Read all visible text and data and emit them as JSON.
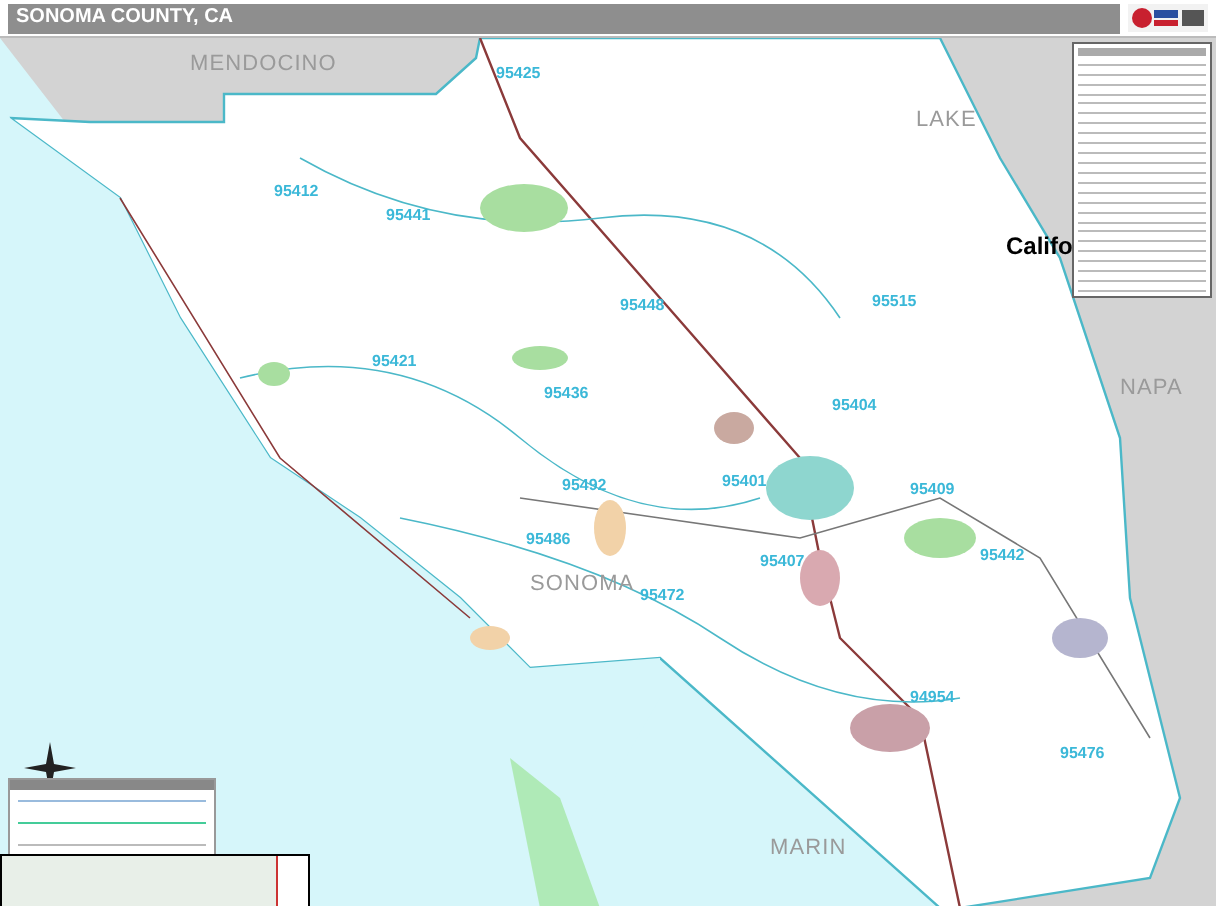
{
  "title": "SONOMA COUNTY, CA",
  "map_labels": [
    {
      "kind": "county",
      "text": "MENDOCINO"
    },
    {
      "kind": "county",
      "text": "LAKE"
    },
    {
      "kind": "state",
      "text": "Califo"
    },
    {
      "kind": "county",
      "text": "NAPA"
    },
    {
      "kind": "county",
      "text": "SONOMA"
    },
    {
      "kind": "county",
      "text": "MARIN"
    },
    {
      "kind": "zip",
      "text": "95425"
    },
    {
      "kind": "zip",
      "text": "95412"
    },
    {
      "kind": "zip",
      "text": "95441"
    },
    {
      "kind": "zip",
      "text": "95448"
    },
    {
      "kind": "zip",
      "text": "95515"
    },
    {
      "kind": "zip",
      "text": "95421"
    },
    {
      "kind": "zip",
      "text": "95436"
    },
    {
      "kind": "zip",
      "text": "95404"
    },
    {
      "kind": "zip",
      "text": "95401"
    },
    {
      "kind": "zip",
      "text": "95409"
    },
    {
      "kind": "zip",
      "text": "95492"
    },
    {
      "kind": "zip",
      "text": "95486"
    },
    {
      "kind": "zip",
      "text": "95472"
    },
    {
      "kind": "zip",
      "text": "95407"
    },
    {
      "kind": "zip",
      "text": "95442"
    },
    {
      "kind": "zip",
      "text": "94954"
    },
    {
      "kind": "zip",
      "text": "95476"
    }
  ]
}
